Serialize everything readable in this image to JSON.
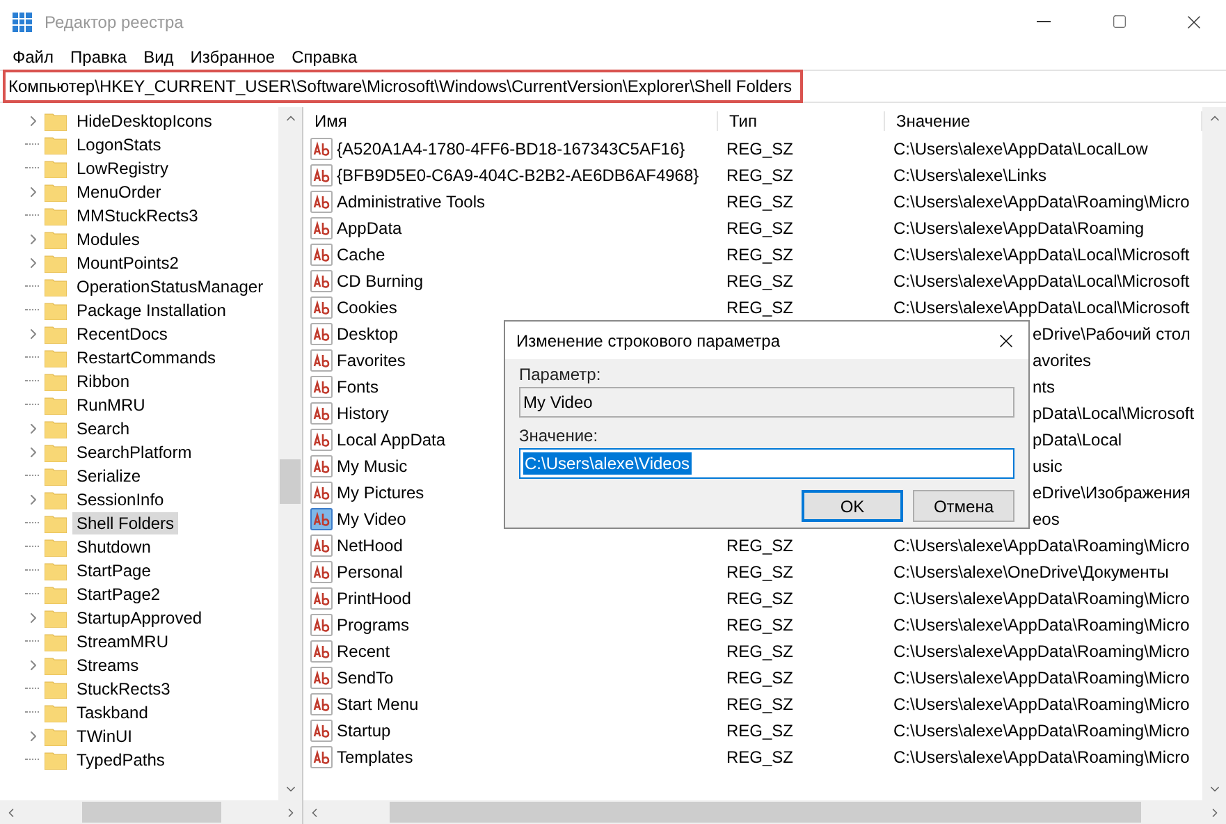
{
  "window": {
    "title": "Редактор реестра"
  },
  "menu": [
    "Файл",
    "Правка",
    "Вид",
    "Избранное",
    "Справка"
  ],
  "address": {
    "path": "Компьютер\\HKEY_CURRENT_USER\\Software\\Microsoft\\Windows\\CurrentVersion\\Explorer\\Shell Folders",
    "highlighted": true
  },
  "tree": {
    "items": [
      {
        "label": "HideDesktopIcons",
        "expandable": true,
        "selected": false
      },
      {
        "label": "LogonStats",
        "expandable": false,
        "selected": false
      },
      {
        "label": "LowRegistry",
        "expandable": false,
        "selected": false
      },
      {
        "label": "MenuOrder",
        "expandable": true,
        "selected": false
      },
      {
        "label": "MMStuckRects3",
        "expandable": false,
        "selected": false
      },
      {
        "label": "Modules",
        "expandable": true,
        "selected": false
      },
      {
        "label": "MountPoints2",
        "expandable": true,
        "selected": false
      },
      {
        "label": "OperationStatusManager",
        "expandable": false,
        "selected": false
      },
      {
        "label": "Package Installation",
        "expandable": false,
        "selected": false
      },
      {
        "label": "RecentDocs",
        "expandable": true,
        "selected": false
      },
      {
        "label": "RestartCommands",
        "expandable": false,
        "selected": false
      },
      {
        "label": "Ribbon",
        "expandable": false,
        "selected": false
      },
      {
        "label": "RunMRU",
        "expandable": false,
        "selected": false
      },
      {
        "label": "Search",
        "expandable": true,
        "selected": false
      },
      {
        "label": "SearchPlatform",
        "expandable": true,
        "selected": false
      },
      {
        "label": "Serialize",
        "expandable": false,
        "selected": false
      },
      {
        "label": "SessionInfo",
        "expandable": true,
        "selected": false
      },
      {
        "label": "Shell Folders",
        "expandable": false,
        "selected": true
      },
      {
        "label": "Shutdown",
        "expandable": false,
        "selected": false
      },
      {
        "label": "StartPage",
        "expandable": false,
        "selected": false
      },
      {
        "label": "StartPage2",
        "expandable": false,
        "selected": false
      },
      {
        "label": "StartupApproved",
        "expandable": true,
        "selected": false
      },
      {
        "label": "StreamMRU",
        "expandable": false,
        "selected": false
      },
      {
        "label": "Streams",
        "expandable": true,
        "selected": false
      },
      {
        "label": "StuckRects3",
        "expandable": false,
        "selected": false
      },
      {
        "label": "Taskband",
        "expandable": false,
        "selected": false
      },
      {
        "label": "TWinUI",
        "expandable": true,
        "selected": false
      },
      {
        "label": "TypedPaths",
        "expandable": false,
        "selected": false
      }
    ]
  },
  "table": {
    "columns": [
      "Имя",
      "Тип",
      "Значение"
    ],
    "rows": [
      {
        "kind": "full",
        "name": "{A520A1A4-1780-4FF6-BD18-167343C5AF16}",
        "type": "REG_SZ",
        "value": "C:\\Users\\alexe\\AppData\\LocalLow",
        "selected": false
      },
      {
        "kind": "full",
        "name": "{BFB9D5E0-C6A9-404C-B2B2-AE6DB6AF4968}",
        "type": "REG_SZ",
        "value": "C:\\Users\\alexe\\Links",
        "selected": false
      },
      {
        "kind": "full",
        "name": "Administrative Tools",
        "type": "REG_SZ",
        "value": "C:\\Users\\alexe\\AppData\\Roaming\\Micro",
        "selected": false
      },
      {
        "kind": "full",
        "name": "AppData",
        "type": "REG_SZ",
        "value": "C:\\Users\\alexe\\AppData\\Roaming",
        "selected": false
      },
      {
        "kind": "full",
        "name": "Cache",
        "type": "REG_SZ",
        "value": "C:\\Users\\alexe\\AppData\\Local\\Microsoft",
        "selected": false
      },
      {
        "kind": "full",
        "name": "CD Burning",
        "type": "REG_SZ",
        "value": "C:\\Users\\alexe\\AppData\\Local\\Microsoft",
        "selected": false
      },
      {
        "kind": "full",
        "name": "Cookies",
        "type": "REG_SZ",
        "value": "C:\\Users\\alexe\\AppData\\Local\\Microsoft",
        "selected": false
      },
      {
        "kind": "partial",
        "name": "Desktop",
        "value": "eDrive\\Рабочий стол",
        "selected": false
      },
      {
        "kind": "partial",
        "name": "Favorites",
        "value": "avorites",
        "selected": false
      },
      {
        "kind": "partial",
        "name": "Fonts",
        "value": "nts",
        "selected": false
      },
      {
        "kind": "partial",
        "name": "History",
        "value": "pData\\Local\\Microsoft",
        "selected": false
      },
      {
        "kind": "partial",
        "name": "Local AppData",
        "value": "pData\\Local",
        "selected": false
      },
      {
        "kind": "partial",
        "name": "My Music",
        "value": "usic",
        "selected": false
      },
      {
        "kind": "partial",
        "name": "My Pictures",
        "value": "eDrive\\Изображения",
        "selected": false
      },
      {
        "kind": "partial",
        "name": "My Video",
        "value": "eos",
        "selected": true
      },
      {
        "kind": "full",
        "name": "NetHood",
        "type": "REG_SZ",
        "value": "C:\\Users\\alexe\\AppData\\Roaming\\Micro",
        "selected": false
      },
      {
        "kind": "full",
        "name": "Personal",
        "type": "REG_SZ",
        "value": "C:\\Users\\alexe\\OneDrive\\Документы",
        "selected": false
      },
      {
        "kind": "full",
        "name": "PrintHood",
        "type": "REG_SZ",
        "value": "C:\\Users\\alexe\\AppData\\Roaming\\Micro",
        "selected": false
      },
      {
        "kind": "full",
        "name": "Programs",
        "type": "REG_SZ",
        "value": "C:\\Users\\alexe\\AppData\\Roaming\\Micro",
        "selected": false
      },
      {
        "kind": "full",
        "name": "Recent",
        "type": "REG_SZ",
        "value": "C:\\Users\\alexe\\AppData\\Roaming\\Micro",
        "selected": false
      },
      {
        "kind": "full",
        "name": "SendTo",
        "type": "REG_SZ",
        "value": "C:\\Users\\alexe\\AppData\\Roaming\\Micro",
        "selected": false
      },
      {
        "kind": "full",
        "name": "Start Menu",
        "type": "REG_SZ",
        "value": "C:\\Users\\alexe\\AppData\\Roaming\\Micro",
        "selected": false
      },
      {
        "kind": "full",
        "name": "Startup",
        "type": "REG_SZ",
        "value": "C:\\Users\\alexe\\AppData\\Roaming\\Micro",
        "selected": false
      },
      {
        "kind": "full",
        "name": "Templates",
        "type": "REG_SZ",
        "value": "C:\\Users\\alexe\\AppData\\Roaming\\Micro",
        "selected": false
      }
    ]
  },
  "dialog": {
    "title": "Изменение строкового параметра",
    "name_label": "Параметр:",
    "name_value": "My Video",
    "name_readonly": true,
    "value_label": "Значение:",
    "value": "C:\\Users\\alexe\\Videos",
    "value_selected": true,
    "buttons": [
      {
        "label": "OK",
        "default": true
      },
      {
        "label": "Отмена",
        "default": false
      }
    ]
  }
}
